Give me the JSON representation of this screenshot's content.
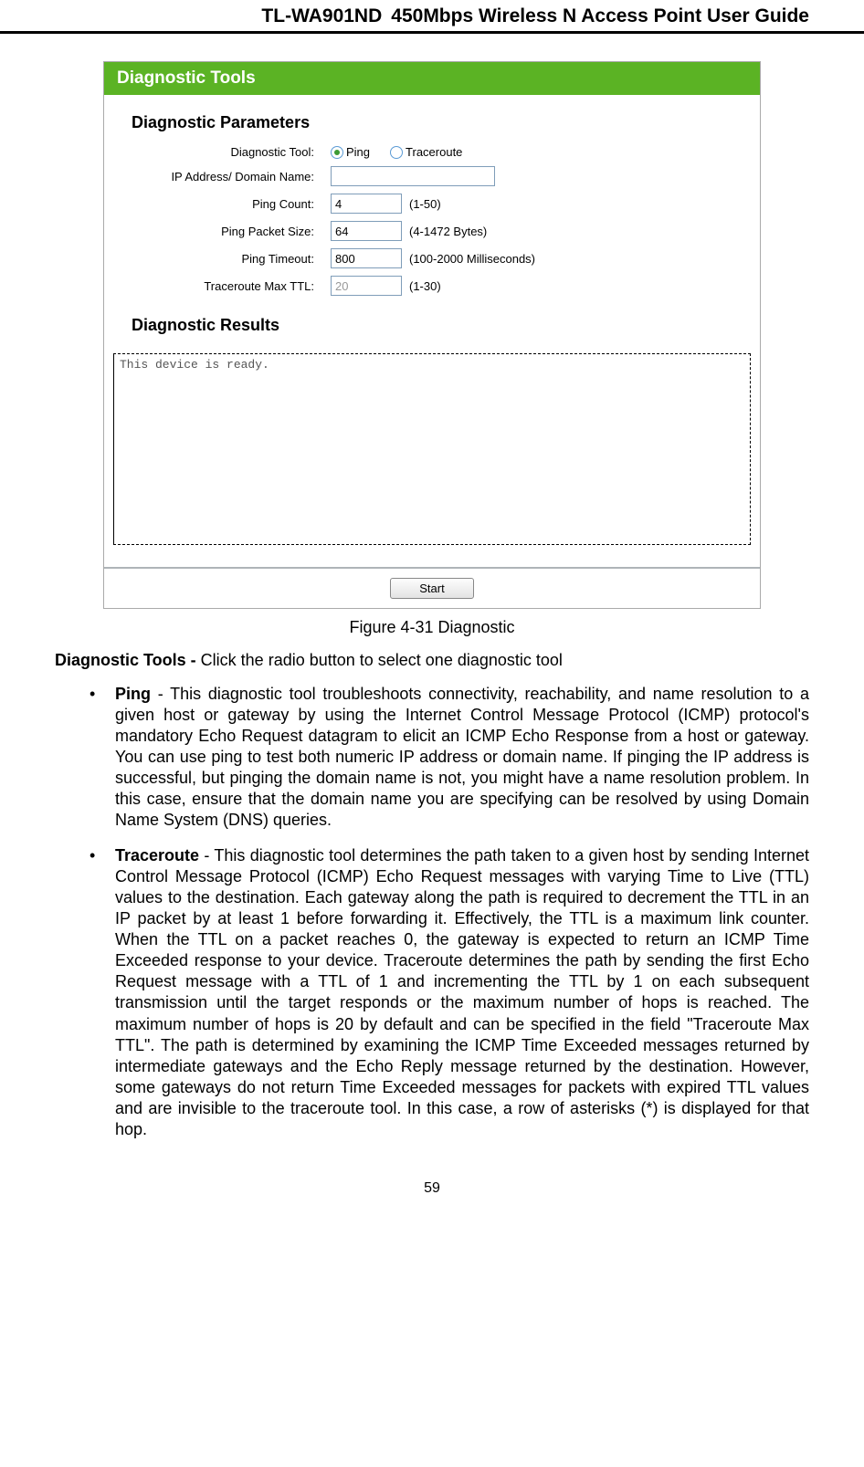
{
  "header": {
    "model": "TL-WA901ND",
    "title": "450Mbps Wireless N Access Point User Guide"
  },
  "ui": {
    "windowTitle": "Diagnostic Tools",
    "paramsHeading": "Diagnostic Parameters",
    "rows": {
      "toolLabel": "Diagnostic Tool:",
      "pingOption": "Ping",
      "tracerouteOption": "Traceroute",
      "ipLabel": "IP Address/ Domain Name:",
      "ipValue": "",
      "countLabel": "Ping Count:",
      "countValue": "4",
      "countHint": "(1-50)",
      "packetLabel": "Ping Packet Size:",
      "packetValue": "64",
      "packetHint": "(4-1472 Bytes)",
      "timeoutLabel": "Ping Timeout:",
      "timeoutValue": "800",
      "timeoutHint": "(100-2000 Milliseconds)",
      "ttlLabel": "Traceroute Max TTL:",
      "ttlValue": "20",
      "ttlHint": "(1-30)"
    },
    "resultsHeading": "Diagnostic Results",
    "resultsText": "This device is ready.",
    "startButton": "Start"
  },
  "caption": "Figure 4-31 Diagnostic",
  "intro": {
    "boldPart": "Diagnostic Tools - ",
    "rest": "Click the radio button to select one diagnostic tool"
  },
  "bullets": {
    "ping": {
      "name": "Ping",
      "text": " - This diagnostic tool troubleshoots connectivity, reachability, and name resolution to a given host or gateway by using the Internet Control Message Protocol (ICMP) protocol's mandatory Echo Request datagram to elicit an ICMP Echo Response from a host or gateway. You can use ping to test both numeric IP address or domain name. If pinging the IP address is successful, but pinging the domain name is not, you might have a name resolution problem. In this case, ensure that the domain name you are specifying can be resolved by using Domain Name System (DNS) queries."
    },
    "traceroute": {
      "name": "Traceroute",
      "text": " - This diagnostic tool determines the path taken to a given host by sending Internet Control Message Protocol (ICMP) Echo Request messages with varying Time to Live (TTL) values to the destination. Each gateway along the path is required to decrement the TTL in an IP packet by at least 1 before forwarding it. Effectively, the TTL is a maximum link counter. When the TTL on a packet reaches 0, the gateway is expected to return an ICMP Time Exceeded response to your device. Traceroute determines the path by sending the first Echo Request message with a TTL of 1 and incrementing the TTL by 1 on each subsequent transmission until the target responds or the maximum number of hops is reached. The maximum number of hops is 20 by default and can be specified in the field \"Traceroute Max TTL\". The path is determined by examining the ICMP Time Exceeded messages returned by intermediate gateways and the Echo Reply message returned by the destination. However, some gateways do not return Time Exceeded messages for packets with expired TTL values and are invisible to the traceroute tool. In this case, a row of asterisks (*) is displayed for that hop."
    }
  },
  "pageNumber": "59"
}
